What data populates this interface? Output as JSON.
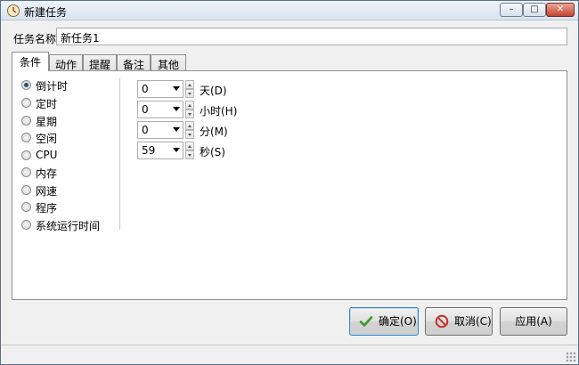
{
  "window": {
    "title": "新建任务"
  },
  "form": {
    "task_name_label": "任务名称",
    "task_name_value": "新任务1"
  },
  "tabs": [
    {
      "label": "条件",
      "active": true
    },
    {
      "label": "动作",
      "active": false
    },
    {
      "label": "提醒",
      "active": false
    },
    {
      "label": "备注",
      "active": false
    },
    {
      "label": "其他",
      "active": false
    }
  ],
  "conditions": [
    {
      "label": "倒计时",
      "checked": true
    },
    {
      "label": "定时",
      "checked": false
    },
    {
      "label": "星期",
      "checked": false
    },
    {
      "label": "空闲",
      "checked": false
    },
    {
      "label": "CPU",
      "checked": false
    },
    {
      "label": "内存",
      "checked": false
    },
    {
      "label": "网速",
      "checked": false
    },
    {
      "label": "程序",
      "checked": false
    },
    {
      "label": "系统运行时间",
      "checked": false
    }
  ],
  "countdown": [
    {
      "value": "0",
      "unit": "天(D)"
    },
    {
      "value": "0",
      "unit": "小时(H)"
    },
    {
      "value": "0",
      "unit": "分(M)"
    },
    {
      "value": "59",
      "unit": "秒(S)"
    }
  ],
  "buttons": {
    "ok": "确定(O)",
    "cancel": "取消(C)",
    "apply": "应用(A)"
  },
  "icons": {
    "app": "app-icon",
    "ok": "check-icon",
    "cancel": "no-entry-icon"
  }
}
